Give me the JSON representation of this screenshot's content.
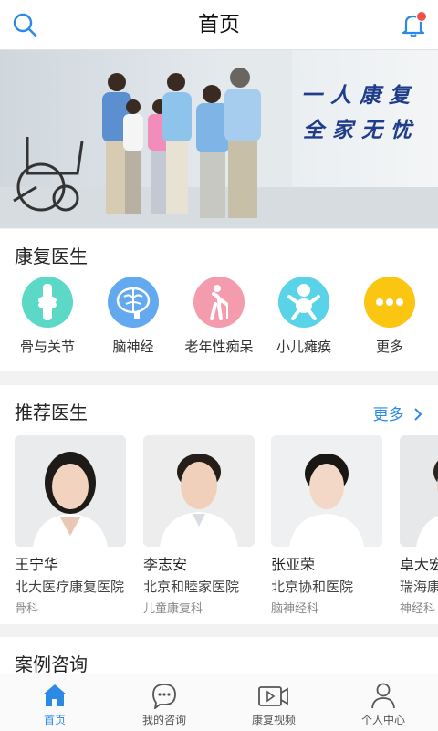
{
  "header": {
    "title": "首页",
    "search_icon": "search-icon",
    "bell_icon": "bell-icon"
  },
  "banner": {
    "line1": "一人康复",
    "line2": "全家无忧"
  },
  "rehab_section": {
    "title": "康复医生",
    "categories": [
      {
        "label": "骨与关节",
        "icon": "joint-icon",
        "color": "#5cd8c6"
      },
      {
        "label": "脑神经",
        "icon": "brain-icon",
        "color": "#62a9f0"
      },
      {
        "label": "老年性痴呆",
        "icon": "elderly-icon",
        "color": "#f49cad"
      },
      {
        "label": "小儿瘫痪",
        "icon": "baby-icon",
        "color": "#58d3e7"
      },
      {
        "label": "更多",
        "icon": "more-dots-icon",
        "color": "#fbc612"
      }
    ]
  },
  "doctors_section": {
    "title": "推荐医生",
    "more_label": "更多",
    "doctors": [
      {
        "name": "王宁华",
        "hospital": "北大医疗康复医院",
        "dept": "骨科"
      },
      {
        "name": "李志安",
        "hospital": "北京和睦家医院",
        "dept": "儿童康复科"
      },
      {
        "name": "张亚荣",
        "hospital": "北京协和医院",
        "dept": "脑神经科"
      },
      {
        "name": "卓大宏",
        "hospital": "瑞海康复医院",
        "dept": "神经科"
      }
    ]
  },
  "cases_section": {
    "title": "案例咨询"
  },
  "tabbar": {
    "tabs": [
      {
        "label": "首页",
        "icon": "home-icon"
      },
      {
        "label": "我的咨询",
        "icon": "chat-icon"
      },
      {
        "label": "康复视频",
        "icon": "video-icon"
      },
      {
        "label": "个人中心",
        "icon": "person-icon"
      }
    ],
    "active_color": "#2b8ae5"
  }
}
